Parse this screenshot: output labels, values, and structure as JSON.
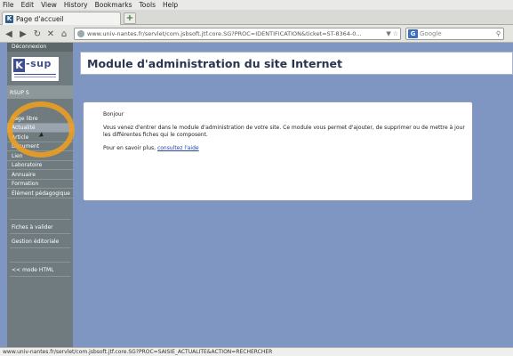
{
  "menubar": [
    "File",
    "Edit",
    "View",
    "History",
    "Bookmarks",
    "Tools",
    "Help"
  ],
  "tab": {
    "title": "Page d'accueil",
    "favicon": "K"
  },
  "newtab_label": "+",
  "nav": {
    "url": "www.univ-nantes.fr/servlet/com.jsbsoft.jtf.core.SG?PROC=IDENTIFICATION&ticket=ST-8364-0...",
    "search_placeholder": "Google",
    "search_engine_letter": "G"
  },
  "sidebar": {
    "deconnexion": "Déconnexion",
    "logo_text": "-sup",
    "logo_letter": "K",
    "site_label": "RSUP S",
    "items": [
      {
        "label": "Page libre",
        "active": false
      },
      {
        "label": "Actualité",
        "active": true
      },
      {
        "label": "Article",
        "active": false
      },
      {
        "label": "Document",
        "active": false
      },
      {
        "label": "Lien",
        "active": false
      },
      {
        "label": "Laboratoire",
        "active": false
      },
      {
        "label": "Annuaire",
        "active": false
      },
      {
        "label": "Formation",
        "active": false
      },
      {
        "label": "Élément pédagogique",
        "active": false
      }
    ],
    "fiches_a_valider": "Fiches à valider",
    "gestion_editoriale": "Gestion éditoriale",
    "mode_html": "<< mode HTML"
  },
  "main": {
    "title": "Module d'administration du site Internet",
    "greeting": "Bonjour",
    "intro": "Vous venez d'entrer dans le module d'administration de votre site. Ce module vous permet d'ajouter, de supprimer ou de mettre à jour les différentes fiches qui le composent.",
    "more_prefix": "Pour en savoir plus,",
    "more_link": "consultez l'aide"
  },
  "statusbar": "www.univ-nantes.fr/servlet/com.jsbsoft.jtf.core.SG?PROC=SAISIE_ACTUALITE&ACTION=RECHERCHER",
  "colors": {
    "page_bg": "#7f96c2",
    "sidebar_bg": "#6f7b7e",
    "highlight": "#f2a01c"
  }
}
